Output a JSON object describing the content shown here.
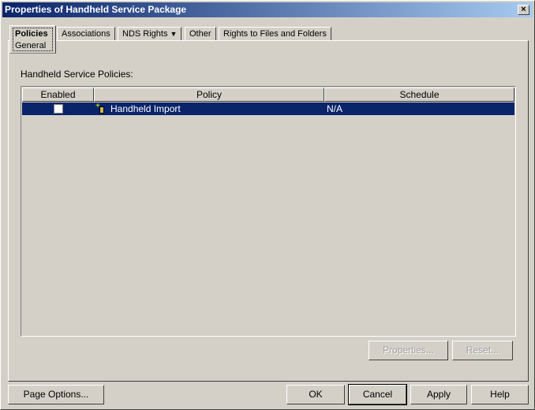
{
  "window": {
    "title": "Properties of Handheld Service Package",
    "close_label": "×"
  },
  "tabs": [
    {
      "label": "Policies",
      "sublabel": "General"
    },
    {
      "label": "Associations"
    },
    {
      "label": "NDS Rights",
      "dropdown": "▼"
    },
    {
      "label": "Other"
    },
    {
      "label": "Rights to Files and Folders"
    }
  ],
  "section_label": "Handheld Service Policies:",
  "table": {
    "columns": [
      "Enabled",
      "Policy",
      "Schedule"
    ],
    "rows": [
      {
        "enabled": false,
        "policy": "Handheld Import",
        "schedule": "N/A"
      }
    ]
  },
  "buttons": {
    "properties": "Properties...",
    "reset": "Reset...",
    "page_options": "Page Options...",
    "ok": "OK",
    "cancel": "Cancel",
    "apply": "Apply",
    "help": "Help"
  }
}
